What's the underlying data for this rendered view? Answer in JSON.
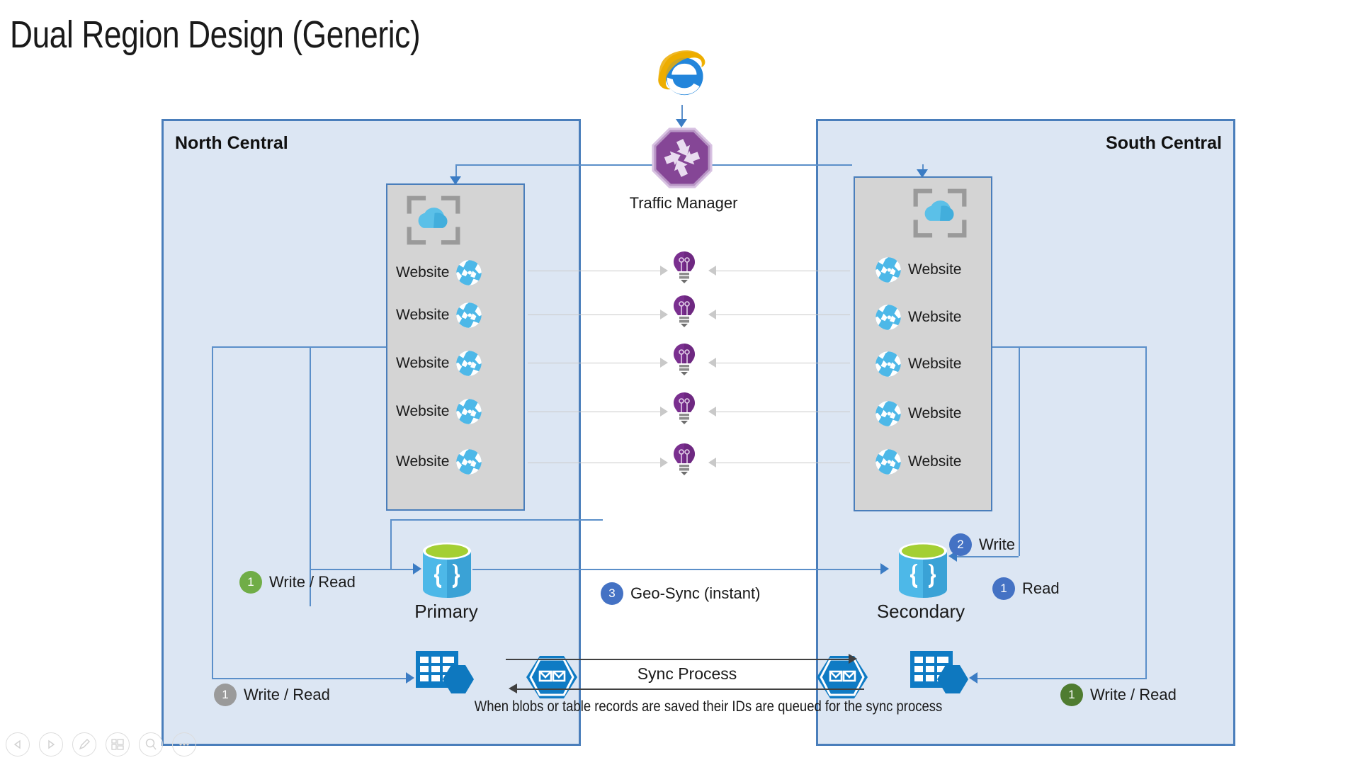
{
  "slide": {
    "title": "Dual Region Design (Generic)"
  },
  "client": {
    "browser_icon": "internet-explorer-icon"
  },
  "traffic_manager": {
    "label": "Traffic Manager",
    "icon": "traffic-manager-icon"
  },
  "regions": [
    {
      "id": "north",
      "title": "North Central",
      "resource_group_icon": "cloud-resource-group-icon",
      "websites": [
        {
          "label": "Website",
          "icon": "web-app-icon"
        },
        {
          "label": "Website",
          "icon": "web-app-icon"
        },
        {
          "label": "Website",
          "icon": "web-app-icon"
        },
        {
          "label": "Website",
          "icon": "web-app-icon"
        },
        {
          "label": "Website",
          "icon": "web-app-icon"
        }
      ],
      "database": {
        "label": "Primary",
        "icon": "cosmos-db-icon"
      },
      "storage": {
        "icon": "table-storage-icon"
      },
      "queue": {
        "icon": "queue-storage-icon"
      },
      "badges": [
        {
          "number": "1",
          "text": "Write / Read",
          "color": "#70ad47"
        },
        {
          "number": "1",
          "text": "Write / Read",
          "color": "#9a9a9a"
        }
      ]
    },
    {
      "id": "south",
      "title": "South Central",
      "resource_group_icon": "cloud-resource-group-icon",
      "websites": [
        {
          "label": "Website",
          "icon": "web-app-icon"
        },
        {
          "label": "Website",
          "icon": "web-app-icon"
        },
        {
          "label": "Website",
          "icon": "web-app-icon"
        },
        {
          "label": "Website",
          "icon": "web-app-icon"
        },
        {
          "label": "Website",
          "icon": "web-app-icon"
        }
      ],
      "database": {
        "label": "Secondary",
        "icon": "cosmos-db-icon"
      },
      "storage": {
        "icon": "table-storage-icon"
      },
      "queue": {
        "icon": "queue-storage-icon"
      },
      "badges": [
        {
          "number": "2",
          "text": "Write",
          "color": "#4472c4"
        },
        {
          "number": "1",
          "text": "Read",
          "color": "#4472c4"
        },
        {
          "number": "1",
          "text": "Write / Read",
          "color": "#4f7c30"
        }
      ]
    }
  ],
  "app_insights": {
    "icon": "lightbulb-icon",
    "count": 5
  },
  "geo_sync": {
    "number": "3",
    "text": "Geo-Sync (instant)",
    "color": "#4472c4"
  },
  "sync_process": {
    "label": "Sync Process",
    "caption": "When blobs or table records are saved their IDs are queued for the sync process"
  },
  "toolbar": {
    "buttons": [
      {
        "name": "previous-slide-button",
        "icon": "triangle-left-icon"
      },
      {
        "name": "next-slide-button",
        "icon": "triangle-right-icon"
      },
      {
        "name": "pen-tool-button",
        "icon": "pen-icon"
      },
      {
        "name": "all-slides-button",
        "icon": "slides-grid-icon"
      },
      {
        "name": "zoom-button",
        "icon": "magnifier-icon"
      },
      {
        "name": "more-options-button",
        "icon": "ellipsis-icon"
      }
    ]
  },
  "colors": {
    "region_fill": "#dce6f3",
    "region_border": "#4a7ebb",
    "resource_group_fill": "#d4d4d4",
    "connector_blue": "#5b8fc9",
    "azure_blue": "#0f7bc4",
    "insights_purple": "#7a2f8f",
    "traffic_manager_purple": "#8b4a9c"
  }
}
